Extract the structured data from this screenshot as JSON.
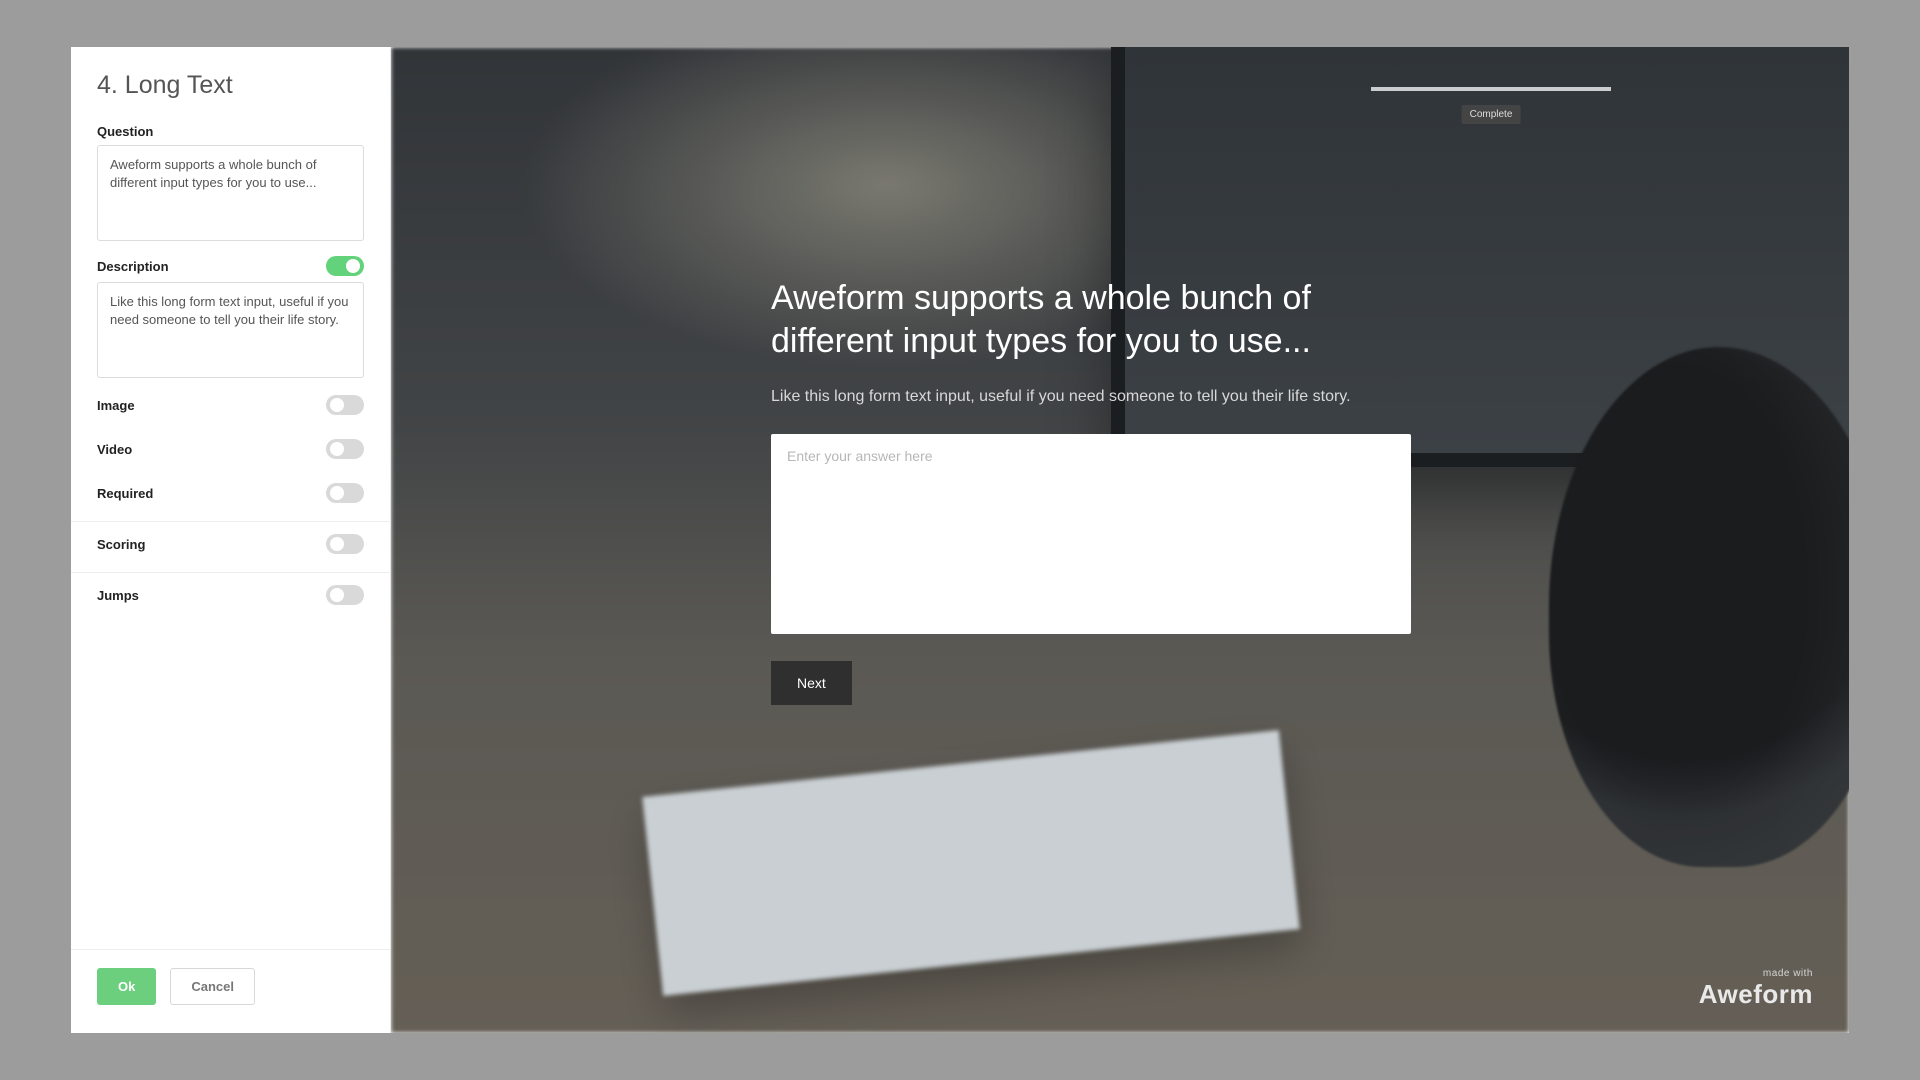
{
  "panel": {
    "title": "4. Long Text",
    "question_label": "Question",
    "question_value": "Aweform supports a whole bunch of different input types for you to use...",
    "description_label": "Description",
    "description_on": true,
    "description_value": "Like this long form text input, useful if you need someone to tell you their life story.",
    "toggles": {
      "image": {
        "label": "Image",
        "on": false
      },
      "video": {
        "label": "Video",
        "on": false
      },
      "required": {
        "label": "Required",
        "on": false
      },
      "scoring": {
        "label": "Scoring",
        "on": false
      },
      "jumps": {
        "label": "Jumps",
        "on": false
      }
    },
    "ok_label": "Ok",
    "cancel_label": "Cancel"
  },
  "preview": {
    "title": "Aweform supports a whole bunch of different input types for you to use...",
    "description": "Like this long form text input, useful if you need someone to tell you their life story.",
    "answer_placeholder": "Enter your answer here",
    "next_label": "Next",
    "monitor_chip": "Complete"
  },
  "brand": {
    "made_with": "made with",
    "name": "Aweform"
  }
}
